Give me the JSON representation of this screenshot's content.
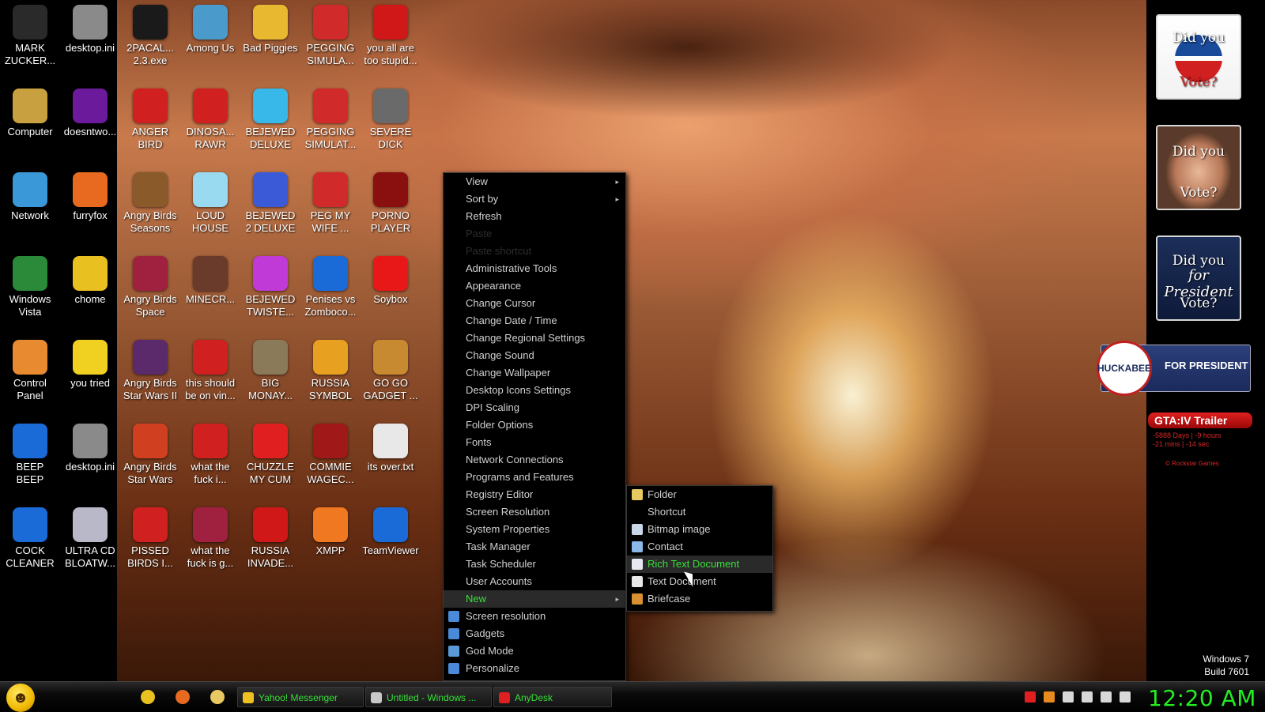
{
  "desktop": {
    "icons": [
      {
        "label": "MARK\nZUCKER...",
        "icon": "person-icon",
        "color": "#2a2a2a"
      },
      {
        "label": "desktop.ini",
        "icon": "settings-file-icon",
        "color": "#8a8a8a"
      },
      {
        "label": "2PACAL...\n2.3.exe",
        "icon": "console-icon",
        "color": "#1a1a1a"
      },
      {
        "label": "Among Us",
        "icon": "folder-icon",
        "color": "#4a9acb"
      },
      {
        "label": "Bad Piggies",
        "icon": "pig-icon",
        "color": "#e8b830"
      },
      {
        "label": "PEGGING\nSIMULA...",
        "icon": "p-logo-icon",
        "color": "#d02a2a"
      },
      {
        "label": "you all are\ntoo stupid...",
        "icon": "devcpp-icon",
        "color": "#d01818"
      },
      {
        "label": "Computer",
        "icon": "computer-icon",
        "color": "#c8a040"
      },
      {
        "label": "doesntwo...",
        "icon": "yahoo-icon",
        "color": "#6a1a9a"
      },
      {
        "label": "ANGER\nBIRD",
        "icon": "angry-bird-icon",
        "color": "#d02020"
      },
      {
        "label": "DINOSA...\nRAWR",
        "icon": "angry-bird-icon",
        "color": "#d02020"
      },
      {
        "label": "BEJEWED\nDELUXE",
        "icon": "gem-icon",
        "color": "#38b8e8"
      },
      {
        "label": "PEGGING\nSIMULAT...",
        "icon": "p-logo-icon",
        "color": "#d02a2a"
      },
      {
        "label": "SEVERE\nDICK",
        "icon": "sd-gear-icon",
        "color": "#6a6a6a"
      },
      {
        "label": "Network",
        "icon": "globe-icon",
        "color": "#3a98d8"
      },
      {
        "label": "furryfox",
        "icon": "firefox-icon",
        "color": "#e86a20"
      },
      {
        "label": "Angry Birds\nSeasons",
        "icon": "angry-bird-icon",
        "color": "#8a5a2a"
      },
      {
        "label": "LOUD\nHOUSE",
        "icon": "folder-icon",
        "color": "#9adaf0"
      },
      {
        "label": "BEJEWED\n2 DELUXE",
        "icon": "gem-icon",
        "color": "#3a5ad8"
      },
      {
        "label": "PEG MY\nWIFE ...",
        "icon": "p-logo-icon",
        "color": "#d02a2a"
      },
      {
        "label": "PORNO\nPLAYER",
        "icon": "flash-icon",
        "color": "#8a1010"
      },
      {
        "label": "Windows\nVista",
        "icon": "recycle-bin-icon",
        "color": "#2a8a3a"
      },
      {
        "label": "chome",
        "icon": "chrome-icon",
        "color": "#e8c020"
      },
      {
        "label": "Angry Birds\nSpace",
        "icon": "angry-bird-icon",
        "color": "#a02040"
      },
      {
        "label": "MINECR...",
        "icon": "minecraft-icon",
        "color": "#6a3a2a"
      },
      {
        "label": "BEJEWED\nTWISTE...",
        "icon": "gem-icon",
        "color": "#c03ad8"
      },
      {
        "label": "Penises vs\nZomboco...",
        "icon": "blue-file-icon",
        "color": "#1a6ad8"
      },
      {
        "label": "Soybox",
        "icon": "soybox-icon",
        "color": "#e81818"
      },
      {
        "label": "Control\nPanel",
        "icon": "control-panel-icon",
        "color": "#e88a30"
      },
      {
        "label": "you tried",
        "icon": "star-icon",
        "color": "#f0d020"
      },
      {
        "label": "Angry Birds\nStar Wars II",
        "icon": "angry-bird-icon",
        "color": "#5a2a6a"
      },
      {
        "label": "this should\nbe on vin...",
        "icon": "angry-bird-icon",
        "color": "#d02020"
      },
      {
        "label": "BIG\nMONAY...",
        "icon": "money-bag-icon",
        "color": "#8a7a5a"
      },
      {
        "label": "RUSSIA\nSYMBOL",
        "icon": "hammer-sickle-icon",
        "color": "#e8a020"
      },
      {
        "label": "GO GO\nGADGET ...",
        "icon": "briefcase-icon",
        "color": "#c88a30"
      },
      {
        "label": "BEEP\nBEEP",
        "icon": "blue-file-icon",
        "color": "#1a6ad8"
      },
      {
        "label": "desktop.ini",
        "icon": "settings-file-icon",
        "color": "#8a8a8a"
      },
      {
        "label": "Angry Birds\nStar Wars",
        "icon": "angry-bird-icon",
        "color": "#d04020"
      },
      {
        "label": "what the\nfuck i...",
        "icon": "angry-bird-icon",
        "color": "#d02020"
      },
      {
        "label": "CHUZZLE\nMY CUM",
        "icon": "chuzzle-icon",
        "color": "#e02020"
      },
      {
        "label": "COMMIE\nWAGEC...",
        "icon": "commie-icon",
        "color": "#a01818"
      },
      {
        "label": "its over.txt",
        "icon": "text-file-icon",
        "color": "#e8e8e8"
      },
      {
        "label": "COCK\nCLEANER",
        "icon": "blue-file-icon",
        "color": "#1a6ad8"
      },
      {
        "label": "ULTRA CD\nBLOATW...",
        "icon": "cd-icon",
        "color": "#b8b8c8"
      },
      {
        "label": "PISSED\nBIRDS I...",
        "icon": "angry-bird-icon",
        "color": "#d02020"
      },
      {
        "label": "what the\nfuck is g...",
        "icon": "angry-bird-icon",
        "color": "#a02040"
      },
      {
        "label": "RUSSIA\nINVADE...",
        "icon": "radiation-icon",
        "color": "#d01818"
      },
      {
        "label": "XMPP",
        "icon": "xampp-icon",
        "color": "#f07820"
      },
      {
        "label": "TeamViewer",
        "icon": "teamviewer-icon",
        "color": "#1a6ad8"
      }
    ]
  },
  "context_menu": {
    "items": [
      {
        "label": "View",
        "state": "normal",
        "submenu": "▸"
      },
      {
        "label": "Sort by",
        "state": "normal",
        "submenu": "▸"
      },
      {
        "label": "Refresh",
        "state": "normal"
      },
      {
        "label": "Paste",
        "state": "disabled"
      },
      {
        "label": "Paste shortcut",
        "state": "disabled"
      },
      {
        "label": "Administrative Tools",
        "state": "normal"
      },
      {
        "label": "Appearance",
        "state": "normal"
      },
      {
        "label": "Change Cursor",
        "state": "normal"
      },
      {
        "label": "Change Date / Time",
        "state": "normal"
      },
      {
        "label": "Change Regional Settings",
        "state": "normal"
      },
      {
        "label": "Change Sound",
        "state": "normal"
      },
      {
        "label": "Change Wallpaper",
        "state": "normal"
      },
      {
        "label": "Desktop Icons Settings",
        "state": "normal"
      },
      {
        "label": "DPI Scaling",
        "state": "normal"
      },
      {
        "label": "Folder Options",
        "state": "normal"
      },
      {
        "label": "Fonts",
        "state": "normal"
      },
      {
        "label": "Network Connections",
        "state": "normal"
      },
      {
        "label": "Programs and Features",
        "state": "normal"
      },
      {
        "label": "Registry Editor",
        "state": "normal"
      },
      {
        "label": "Screen Resolution",
        "state": "normal"
      },
      {
        "label": "System Properties",
        "state": "normal"
      },
      {
        "label": "Task Manager",
        "state": "normal"
      },
      {
        "label": "Task Scheduler",
        "state": "normal"
      },
      {
        "label": "User Accounts",
        "state": "normal"
      },
      {
        "label": "New",
        "state": "active",
        "submenu": "▸"
      },
      {
        "label": "Screen resolution",
        "state": "normal",
        "icon": "monitor-icon",
        "color": "#4a8ad8"
      },
      {
        "label": "Gadgets",
        "state": "normal",
        "icon": "gadgets-icon",
        "color": "#4a8ad8"
      },
      {
        "label": "God Mode",
        "state": "normal",
        "icon": "god-mode-icon",
        "color": "#5a9ad8"
      },
      {
        "label": "Personalize",
        "state": "normal",
        "icon": "personalize-icon",
        "color": "#4a8ad8"
      }
    ]
  },
  "new_submenu": {
    "items": [
      {
        "label": "Folder",
        "icon": "folder-icon",
        "color": "#e8c860",
        "state": "normal"
      },
      {
        "label": "Shortcut",
        "icon": "shortcut-icon",
        "color": "#000000",
        "state": "normal"
      },
      {
        "label": "Bitmap image",
        "icon": "bitmap-icon",
        "color": "#c8d8e8",
        "state": "normal"
      },
      {
        "label": "Contact",
        "icon": "contact-icon",
        "color": "#8ab8e8",
        "state": "normal"
      },
      {
        "label": "Rich Text Document",
        "icon": "rtf-icon",
        "color": "#e8e8f0",
        "state": "highlight"
      },
      {
        "label": "Text Document",
        "icon": "text-file-icon",
        "color": "#e8e8e8",
        "state": "normal"
      },
      {
        "label": "Briefcase",
        "icon": "briefcase-icon",
        "color": "#d89030",
        "state": "normal"
      }
    ]
  },
  "widgets": {
    "vote_cards": [
      {
        "top": "Did you",
        "bottom": "Vote?",
        "style": "obama"
      },
      {
        "top": "Did you",
        "bottom": "Vote?",
        "style": "mccain"
      },
      {
        "top": "Did you",
        "middle": "for President",
        "bottom": "Vote?",
        "style": "navy"
      }
    ],
    "huckabee": {
      "seal": "HUCKABEE",
      "text": "FOR PRESIDENT"
    },
    "gta": {
      "title": "GTA:IV Trailer",
      "countdown_line1": "-5888 Days | -9 hours",
      "countdown_line2": "-21 mins | -14 sec",
      "credit": "© Rockstar Games"
    },
    "windows_version": {
      "line1": "Windows 7",
      "line2": "Build 7601"
    }
  },
  "taskbar": {
    "start_icon": "smiley-icon",
    "quick_launch": [
      {
        "icon": "chrome-icon",
        "color": "#e8c020"
      },
      {
        "icon": "firefox-icon",
        "color": "#e86a20"
      },
      {
        "icon": "explorer-folder-icon",
        "color": "#e8c860"
      }
    ],
    "tasks": [
      {
        "label": "Yahoo! Messenger",
        "icon": "yahoo-smiley-icon",
        "color": "#f0c020"
      },
      {
        "label": "Untitled - Windows ...",
        "icon": "paint-icon",
        "color": "#c8c8c8"
      },
      {
        "label": "AnyDesk",
        "icon": "anydesk-icon",
        "color": "#e02020"
      }
    ],
    "tray": [
      {
        "icon": "anydesk-tray-icon",
        "color": "#e02020"
      },
      {
        "icon": "search-tray-icon",
        "color": "#e88a20"
      },
      {
        "icon": "messenger-tray-icon",
        "color": "#d8d8d8"
      },
      {
        "icon": "action-center-flag-icon",
        "color": "#d8d8d8"
      },
      {
        "icon": "network-tray-icon",
        "color": "#d8d8d8"
      },
      {
        "icon": "volume-icon",
        "color": "#d8d8d8"
      }
    ],
    "clock": "12:20 AM"
  },
  "colors": {
    "accent_green": "#38e038",
    "clock_green": "#22ee22",
    "menu_bg": "#000000"
  }
}
